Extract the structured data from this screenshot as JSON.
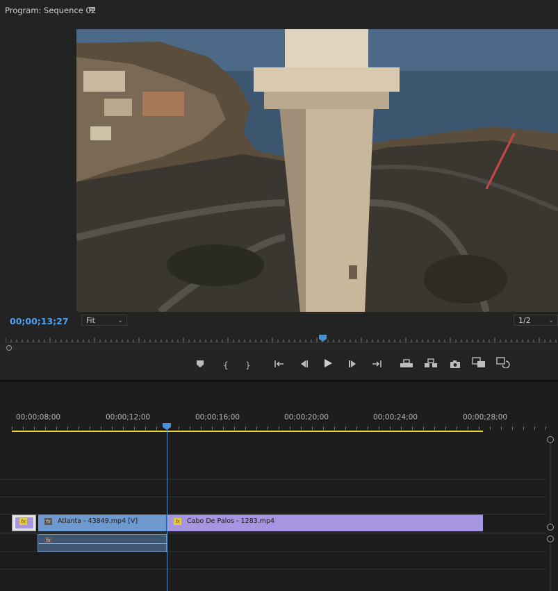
{
  "monitor": {
    "title": "Program: Sequence 02",
    "menu_icon": "≡",
    "timecode": "00;00;13;27",
    "fit": "Fit",
    "resolution": "1/2"
  },
  "transport": {
    "buttons": [
      {
        "name": "add-marker-icon",
        "glyph": "⬟"
      },
      {
        "name": "mark-in-icon",
        "glyph": "{"
      },
      {
        "name": "mark-out-icon",
        "glyph": "}"
      },
      {
        "name": "go-to-in-icon",
        "glyph": "{⇤"
      },
      {
        "name": "step-back-icon",
        "glyph": "◀|"
      },
      {
        "name": "play-icon",
        "glyph": "▶"
      },
      {
        "name": "step-forward-icon",
        "glyph": "|▶"
      },
      {
        "name": "go-to-out-icon",
        "glyph": "⇥}"
      },
      {
        "name": "lift-icon",
        "glyph": "⏏"
      },
      {
        "name": "extract-icon",
        "glyph": "⏏"
      },
      {
        "name": "export-frame-icon",
        "glyph": "📷"
      },
      {
        "name": "comparison-view-icon",
        "glyph": "▦"
      },
      {
        "name": "toggle-proxies-icon",
        "glyph": "⟲"
      }
    ]
  },
  "timeline": {
    "timecodes": [
      "00;00;08;00",
      "00;00;12;00",
      "00;00;16;00",
      "00;00;20;00",
      "00;00;24;00",
      "00;00;28;00"
    ],
    "clips": {
      "fx_label": "fx",
      "atlanta": "Atlanta - 43849.mp4 [V]",
      "cabo": "Cabo De Palos - 1283.mp4"
    }
  },
  "colors": {
    "accent_blue": "#4aa3f5",
    "clip_blue": "#6f9ad0",
    "clip_purple": "#a695e0",
    "work_area": "#e8d52a"
  }
}
